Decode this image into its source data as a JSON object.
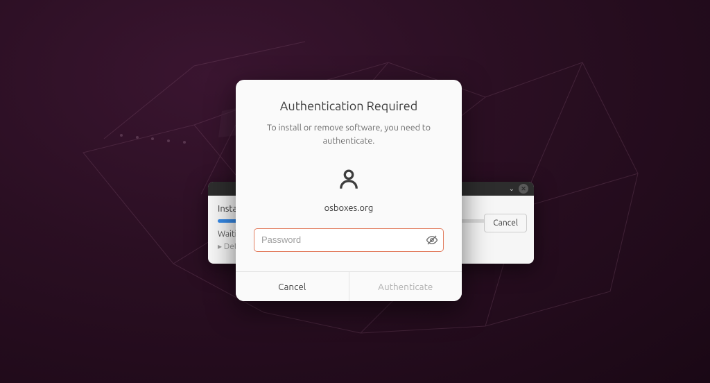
{
  "installer": {
    "label": "Install",
    "status": "Waiting",
    "details": "Det",
    "cancel_label": "Cancel"
  },
  "auth": {
    "title": "Authentication Required",
    "subtitle": "To install or remove software, you need to authenticate.",
    "username": "osboxes.org",
    "password_placeholder": "Password",
    "cancel_label": "Cancel",
    "authenticate_label": "Authenticate"
  }
}
